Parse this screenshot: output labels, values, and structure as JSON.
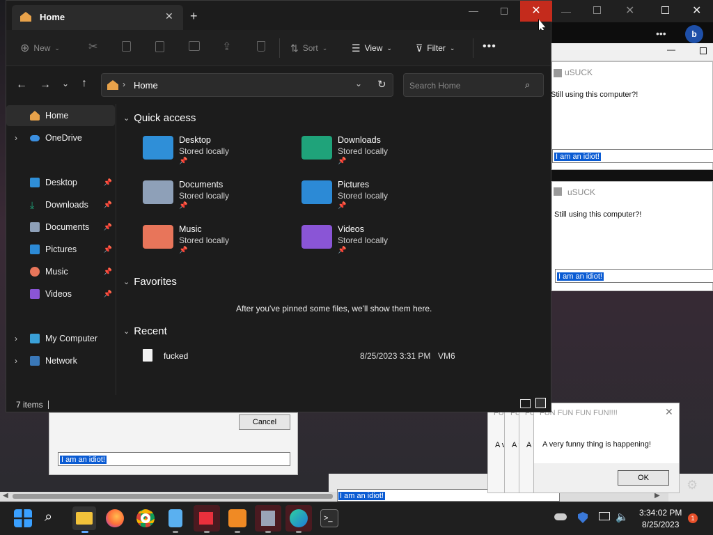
{
  "bg_windows": {
    "usuck1": {
      "title": "uSUCK",
      "message": "Still using this computer?!",
      "input": "I am an idiot!"
    },
    "usuck2": {
      "title": "uSUCK",
      "message": "Still using this computer?!",
      "input": "I am an idiot!"
    },
    "left_dialog": {
      "cancel_label": "Cancel",
      "input": "I am an idiot!"
    },
    "bottom_input": "I am an idiot!",
    "fun": {
      "title": "FUN FUN FUN FUN!!!!",
      "message": "A very funny thing is happening!",
      "ok_label": "OK",
      "stack_prefix": "A v",
      "stack_title_prefix": "FU"
    }
  },
  "explorer": {
    "tab_title": "Home",
    "toolbar": {
      "new": "New",
      "sort": "Sort",
      "view": "View",
      "filter": "Filter"
    },
    "address": {
      "path": "Home",
      "search_placeholder": "Search Home"
    },
    "sidebar": {
      "home": "Home",
      "onedrive": "OneDrive",
      "pinned": [
        "Desktop",
        "Downloads",
        "Documents",
        "Pictures",
        "Music",
        "Videos"
      ],
      "my_computer": "My Computer",
      "network": "Network"
    },
    "sections": {
      "quick_access": "Quick access",
      "favorites": "Favorites",
      "recent": "Recent"
    },
    "quick_access": [
      {
        "name": "Desktop",
        "sub": "Stored locally",
        "color": "#2f8fd8"
      },
      {
        "name": "Downloads",
        "sub": "Stored locally",
        "color": "#1fa37a"
      },
      {
        "name": "Documents",
        "sub": "Stored locally",
        "color": "#8ea0b8"
      },
      {
        "name": "Pictures",
        "sub": "Stored locally",
        "color": "#2c8ad6"
      },
      {
        "name": "Music",
        "sub": "Stored locally",
        "color": "#e8755a"
      },
      {
        "name": "Videos",
        "sub": "Stored locally",
        "color": "#8a55d6"
      }
    ],
    "favorites_empty": "After you've pinned some files, we'll show them here.",
    "recent": [
      {
        "name": "fucked",
        "date": "8/25/2023 3:31 PM",
        "location": "VM6"
      }
    ],
    "status": "7 items"
  },
  "taskbar": {
    "time": "3:34:02 PM",
    "date": "8/25/2023",
    "notification_count": "1"
  },
  "colors": {
    "accent_close": "#c42b1c",
    "explorer_bg": "#1c1c1c",
    "selection": "#0a5bd3"
  }
}
